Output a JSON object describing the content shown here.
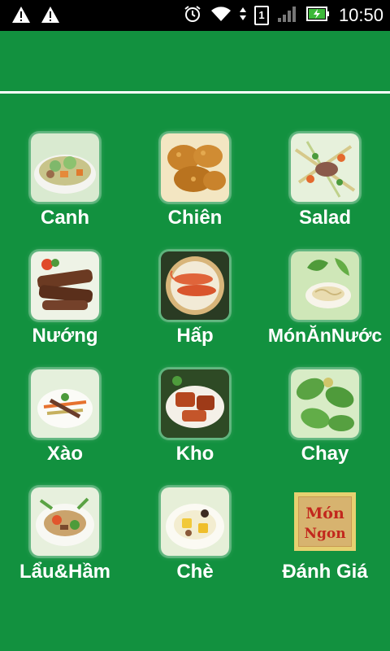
{
  "status_bar": {
    "time": "10:50",
    "sim_slot": "1",
    "icons": [
      "warning-icon",
      "warning-icon",
      "alarm-icon",
      "wifi-icon",
      "sim-icon",
      "signal-icon",
      "battery-charging-icon"
    ]
  },
  "colors": {
    "background": "#12913f",
    "status_bar": "#000000",
    "text": "#ffffff"
  },
  "menu": {
    "items": [
      {
        "label": "Canh",
        "icon": "soup-dish-icon"
      },
      {
        "label": "Chiên",
        "icon": "fried-chicken-icon"
      },
      {
        "label": "Salad",
        "icon": "salad-icon"
      },
      {
        "label": "Nướng",
        "icon": "grilled-meat-icon"
      },
      {
        "label": "Hấp",
        "icon": "steamed-shrimp-icon"
      },
      {
        "label": "MónĂnNước",
        "icon": "noodle-soup-icon"
      },
      {
        "label": "Xào",
        "icon": "stir-fry-icon"
      },
      {
        "label": "Kho",
        "icon": "braised-fish-icon"
      },
      {
        "label": "Chay",
        "icon": "vegetarian-roll-icon"
      },
      {
        "label": "Lẩu&Hầm",
        "icon": "hotpot-icon"
      },
      {
        "label": "Chè",
        "icon": "dessert-icon"
      },
      {
        "label": "Đánh Giá",
        "icon": "rating-sign-icon"
      }
    ],
    "rating_sign_text": [
      "Món",
      "Ngon"
    ]
  }
}
